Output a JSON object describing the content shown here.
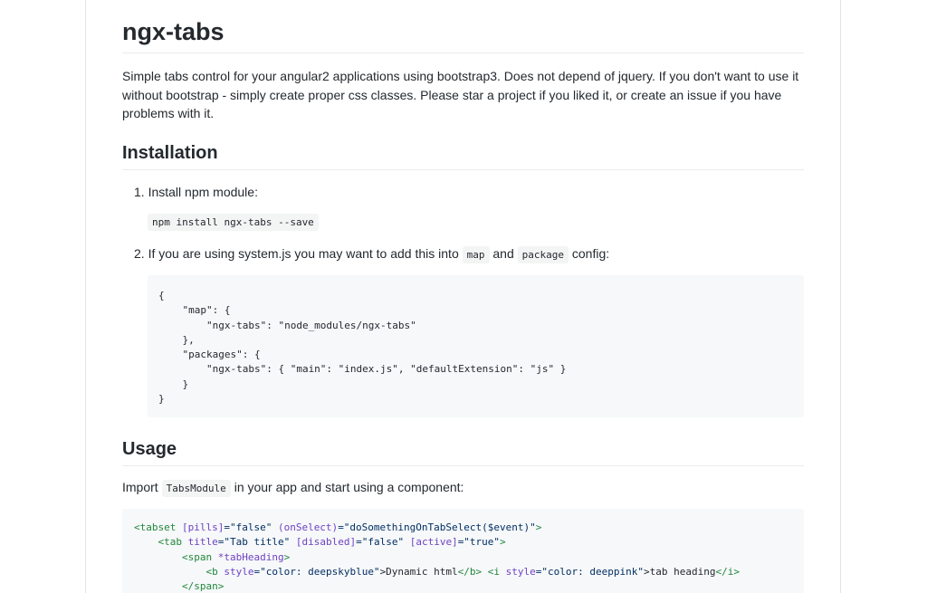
{
  "title": "ngx-tabs",
  "intro": "Simple tabs control for your angular2 applications using bootstrap3. Does not depend of jquery. If you don't want to use it without bootstrap - simply create proper css classes. Please star a project if you liked it, or create an issue if you have problems with it.",
  "installation": {
    "heading": "Installation",
    "step1": "1. Install npm module:",
    "npm_command": "npm install ngx-tabs --save",
    "step2_pre": "2. If you are using system.js you may want to add this into",
    "step2_code_map": "map",
    "step2_and": "and",
    "step2_code_package": "package",
    "step2_post": "config:",
    "config_code": "{\n    \"map\": {\n        \"ngx-tabs\": \"node_modules/ngx-tabs\"\n    },\n    \"packages\": {\n        \"ngx-tabs\": { \"main\": \"index.js\", \"defaultExtension\": \"js\" }\n    }\n}"
  },
  "usage": {
    "heading": "Usage",
    "text_pre": "Import",
    "text_code": "TabsModule",
    "text_post": "in your app and start using a component:",
    "code_lines": {
      "l1_open": "<tabset",
      "l1_attr1": "[pills]",
      "l1_val1": "=\"false\"",
      "l1_attr2": "(onSelect)",
      "l1_val2": "=\"doSomethingOnTabSelect($event)\"",
      "l1_close": ">",
      "l2_open": "<tab",
      "l2_attr1": "title",
      "l2_val1": "=\"Tab title\"",
      "l2_attr2": "[disabled]",
      "l2_val2": "=\"false\"",
      "l2_attr3": "[active]",
      "l2_val3": "=\"true\"",
      "l2_close": ">",
      "l3_open": "<span",
      "l3_attr": "*tabHeading",
      "l3_close": ">",
      "l4_b_open": "<b",
      "l4_attr1": "style",
      "l4_val1": "=\"color: deepskyblue\"",
      "l4_text1": ">Dynamic html",
      "l4_b_close": "</b>",
      "l4_i_open": "<i",
      "l4_attr2": "style",
      "l4_val2": "=\"color: deeppink\"",
      "l4_text2": ">tab heading",
      "l4_i_close": "</i>",
      "l5": "</span>"
    }
  }
}
